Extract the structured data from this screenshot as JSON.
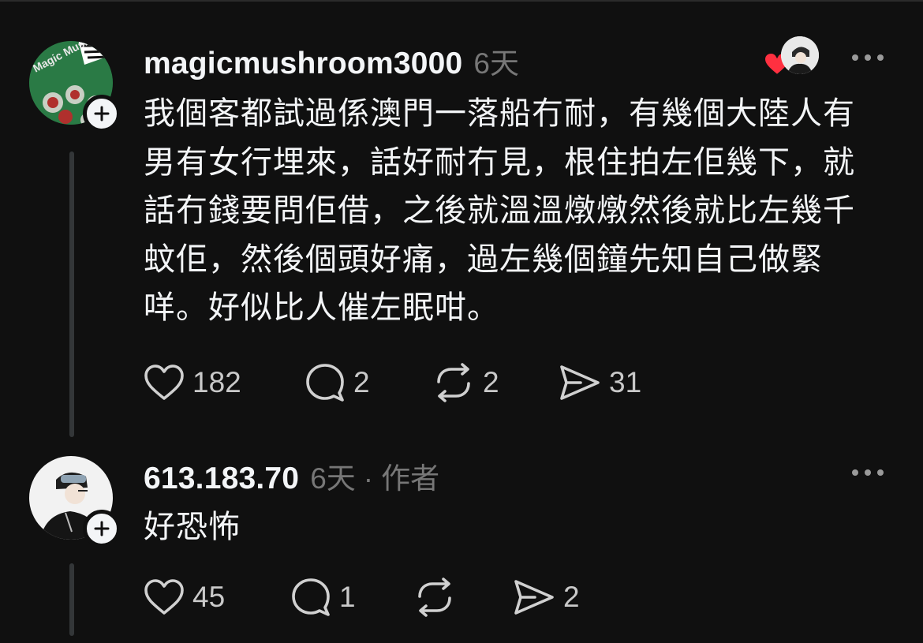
{
  "posts": [
    {
      "username": "magicmushroom3000",
      "time": "6天",
      "body": "我個客都試過係澳門一落船冇耐，有幾個大陸人有男有女行埋來，話好耐冇見，根住拍左佢幾下，就話冇錢要問佢借，之後就溫溫燉燉然後就比左幾千蚊佢，然後個頭好痛，過左幾個鐘先知自己做緊咩。好似比人催左眠咁。",
      "likes": "182",
      "replies": "2",
      "reposts": "2",
      "shares": "31",
      "avatar_text": "Magic Mush"
    },
    {
      "username": "613.183.70",
      "time": "6天",
      "author_sep": "·",
      "author_label": "作者",
      "body": "好恐怖",
      "likes": "45",
      "replies": "1",
      "shares": "2"
    }
  ],
  "colors": {
    "background": "#101010",
    "text": "#f3f5f7",
    "muted": "#777777",
    "heart_red": "#ff3040",
    "thread_line": "#333638"
  },
  "icons": [
    "plus-icon",
    "more-icon",
    "heart-icon",
    "comment-icon",
    "repost-icon",
    "share-icon"
  ]
}
